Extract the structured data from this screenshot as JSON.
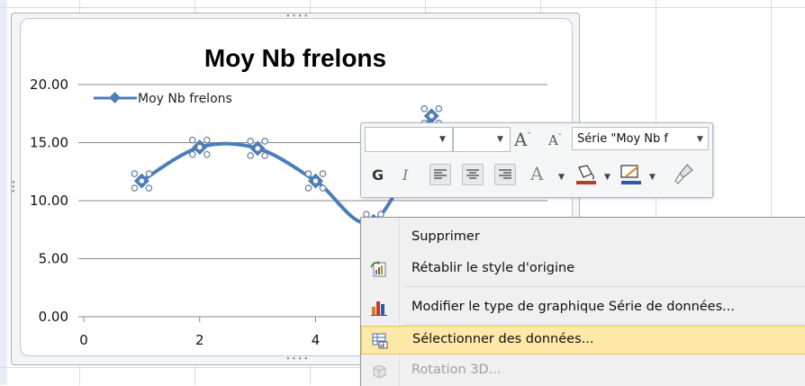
{
  "chart_data": {
    "type": "line",
    "title": "Moy Nb frelons",
    "x": [
      1,
      2,
      3,
      4,
      5,
      6
    ],
    "series": [
      {
        "name": "Moy Nb frelons",
        "values": [
          11.7,
          14.6,
          14.5,
          11.7,
          8.2,
          17.3
        ],
        "color": "#4a7ebb"
      }
    ],
    "xlim": [
      0,
      8
    ],
    "ylim": [
      0,
      20
    ],
    "x_ticks": [
      "0",
      "2",
      "4"
    ],
    "y_ticks": [
      "0.00",
      "5.00",
      "10.00",
      "15.00",
      "20.00"
    ],
    "grid": "horizontal",
    "legend": "top-left"
  },
  "minitoolbar": {
    "font_grow": "A",
    "font_shrink": "A",
    "series_select": "Série \"Moy Nb f",
    "bold": "G",
    "italic": "I",
    "font_color_glyph": "A"
  },
  "context_menu": {
    "items": [
      {
        "label": "Supprimer",
        "icon": "none",
        "enabled": true
      },
      {
        "label": "Rétablir le style d'origine",
        "icon": "reset-style-icon",
        "enabled": true
      },
      {
        "label": "Modifier le type de graphique Série de données...",
        "icon": "chart-type-icon",
        "enabled": true
      },
      {
        "label": "Sélectionner des données...",
        "icon": "select-data-icon",
        "enabled": true,
        "highlighted": true
      },
      {
        "label": "Rotation 3D...",
        "icon": "rotation-3d-icon",
        "enabled": false
      }
    ]
  },
  "colors": {
    "series": "#4a7ebb",
    "menu_highlight": "#ffe9a8",
    "fill_color": "#c0392b",
    "line_color": "#2a5aa8"
  }
}
